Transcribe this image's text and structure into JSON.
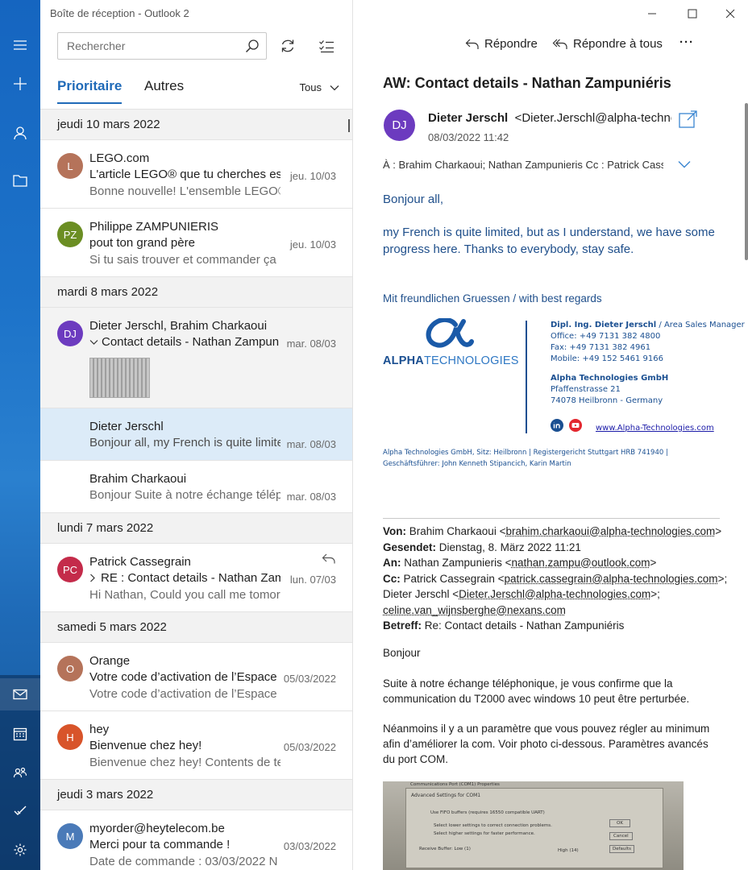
{
  "window": {
    "title": "Boîte de réception - Outlook 2"
  },
  "search": {
    "placeholder": "Rechercher"
  },
  "tabs": {
    "focused": "Prioritaire",
    "other": "Autres",
    "filter": "Tous"
  },
  "groups": [
    {
      "date": "jeudi 10 mars 2022"
    },
    {
      "date": "mardi 8 mars 2022"
    },
    {
      "date": "lundi 7 mars 2022"
    },
    {
      "date": "samedi 5 mars 2022"
    },
    {
      "date": "jeudi 3 mars 2022"
    }
  ],
  "messages": [
    {
      "initials": "L",
      "color": "#b5735a",
      "sender": "LEGO.com",
      "subject": "L'article LEGO® que tu cherches est",
      "preview": "Bonne nouvelle! L'ensemble LEGO®",
      "date": "jeu. 10/03"
    },
    {
      "initials": "PZ",
      "color": "#6b8e23",
      "sender": "Philippe ZAMPUNIERIS",
      "subject": "pout ton grand père",
      "preview": "Si tu sais trouver et commander ça :",
      "date": "jeu. 10/03"
    },
    {
      "initials": "DJ",
      "color": "#6c3bbf",
      "sender": "Dieter Jerschl, Brahim Charkaoui",
      "subject": "Contact details - Nathan Zampun",
      "preview": "",
      "date": "mar. 08/03"
    },
    {
      "initials": "",
      "color": "",
      "sender": "Dieter Jerschl",
      "subject": "Bonjour all, my French is quite limite",
      "preview": "",
      "date": "mar. 08/03"
    },
    {
      "initials": "",
      "color": "",
      "sender": "Brahim Charkaoui",
      "subject": "Bonjour Suite à notre échange télép",
      "preview": "",
      "date": "mar. 08/03"
    },
    {
      "initials": "PC",
      "color": "#c42b4a",
      "sender": "Patrick Cassegrain",
      "subject": "RE : Contact details - Nathan Zamp",
      "preview": "Hi Nathan, Could you call me tomori",
      "date": "lun. 07/03"
    },
    {
      "initials": "O",
      "color": "#b5735a",
      "sender": "Orange",
      "subject": "Votre code d’activation de l’Espace",
      "preview": "Votre code d’activation de l’Espace",
      "date": "05/03/2022"
    },
    {
      "initials": "H",
      "color": "#d8542a",
      "sender": "hey",
      "subject": "Bienvenue chez hey!",
      "preview": "Bienvenue chez hey! Contents de te",
      "date": "05/03/2022"
    },
    {
      "initials": "M",
      "color": "#4a7ab8",
      "sender": "myorder@heytelecom.be",
      "subject": "Merci pour ta commande !",
      "preview": "Date de commande : 03/03/2022 N",
      "date": "03/03/2022"
    }
  ],
  "reading": {
    "actions": {
      "reply": "Répondre",
      "reply_all": "Répondre à tous",
      "more": "···"
    },
    "subject": "AW: Contact details - Nathan Zampuniéris",
    "avatar": "DJ",
    "from_name": "Dieter Jerschl",
    "from_addr": "<Dieter.Jerschl@alpha-technol",
    "date": "08/03/2022 11:42",
    "to_label": "À :",
    "to": "Brahim Charkaoui; Nathan Zampunieris",
    "cc_label": "Cc :",
    "cc": "Patrick Cass...",
    "greeting": "Bonjour all,",
    "para1a": "my French is quite limited, but as I understand, we have some",
    "para1b": "progress here. Thanks to everybody, stay safe.",
    "regards": "Mit freundlichen Gruessen / with best regards",
    "logo_bold": "ALPHA",
    "logo_rest": "TECHNOLOGIES",
    "sig_name": "Dipl. Ing. Dieter Jerschl",
    "sig_role": "/ Area Sales Manager",
    "sig_office": "Office: +49 7131 382 4800",
    "sig_fax": "Fax: +49 7131 382 4961",
    "sig_mobile": "Mobile: +49 152 5461 9166",
    "sig_company": "Alpha Technologies GmbH",
    "sig_street": "Pfaffenstrasse 21",
    "sig_city": "74078 Heilbronn - Germany",
    "sig_web": "www.Alpha-Technologies.com",
    "legal1": "Alpha Technologies GmbH, Sitz: Heilbronn | Registergericht Stuttgart HRB 741940 |",
    "legal2": "Geschäftsführer: John Kenneth Stipancich, Karin Martin",
    "q_von_label": "Von:",
    "q_von": "Brahim Charkaoui <",
    "q_von_email": "brahim.charkaoui@alpha-technologies.com",
    "q_gesendet_label": "Gesendet:",
    "q_gesendet": "Dienstag, 8. März 2022 11:21",
    "q_an_label": "An:",
    "q_an": "Nathan Zampunieris <",
    "q_an_email": "nathan.zampu@outlook.com",
    "q_cc_label": "Cc:",
    "q_cc1": "Patrick Cassegrain <",
    "q_cc1_email": "patrick.cassegrain@alpha-technologies.com",
    "q_cc2": "Dieter Jerschl <",
    "q_cc2_email": "Dieter.Jerschl@alpha-technologies.com",
    "q_cc3_email": "celine.van_wijnsberghe@nexans.com",
    "q_betreff_label": "Betreff:",
    "q_betreff": "Re: Contact details - Nathan Zampuniéris",
    "q_bonjour": "Bonjour",
    "q_p1a": "Suite à notre échange téléphonique, je vous confirme que la",
    "q_p1b": "communication du T2000 avec windows 10 peut être perturbée.",
    "q_p2a": "Néanmoins il y a un paramètre que vous pouvez régler au minimum",
    "q_p2b": "afin d’améliorer la com. Voir photo ci-dessous. Paramètres avancés",
    "q_p2c": "du port COM.",
    "photo_title": "Communications Port (COM1) Properties",
    "photo_dialog": "Advanced Settings for COM1",
    "photo_fifo": "Use FIFO buffers (requires 16550 compatible UART)",
    "photo_low": "Select lower settings to correct connection problems.",
    "photo_high": "Select higher settings for faster performance.",
    "photo_rx": "Receive Buffer:  Low (1)",
    "photo_ok": "OK",
    "photo_cancel": "Cancel",
    "photo_defaults": "Defaults",
    "photo_hi": "High (14)"
  }
}
